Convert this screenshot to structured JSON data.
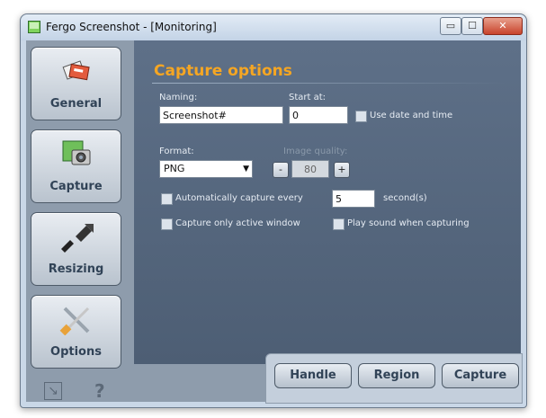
{
  "window": {
    "title": "Fergo Screenshot - [Monitoring]",
    "controls": {
      "minimize": "▭",
      "maximize": "☐",
      "close": "✕"
    }
  },
  "sidebar": {
    "items": [
      {
        "label": "General",
        "icon": "cards-icon"
      },
      {
        "label": "Capture",
        "icon": "camera-icon"
      },
      {
        "label": "Resizing",
        "icon": "resize-arrows-icon"
      },
      {
        "label": "Options",
        "icon": "tools-icon"
      }
    ],
    "footer": {
      "help": "?"
    }
  },
  "panel": {
    "title": "Capture options",
    "naming": {
      "label": "Naming:",
      "value": "Screenshot#"
    },
    "start_at": {
      "label": "Start at:",
      "value": "0"
    },
    "use_date_time": {
      "label": "Use date and time",
      "checked": false
    },
    "format": {
      "label": "Format:",
      "value": "PNG"
    },
    "image_quality": {
      "label": "Image quality:",
      "value": "80",
      "minus": "-",
      "plus": "+"
    },
    "auto_capture": {
      "label": "Automatically capture every",
      "checked": false,
      "value": "5",
      "unit": "second(s)"
    },
    "active_window": {
      "label": "Capture only active window",
      "checked": false
    },
    "play_sound": {
      "label": "Play sound when capturing",
      "checked": false
    }
  },
  "actions": {
    "handle": "Handle",
    "region": "Region",
    "capture": "Capture"
  },
  "colors": {
    "accent": "#f5a623",
    "panel": "#56677d",
    "sidebar": "#8e9cac"
  }
}
